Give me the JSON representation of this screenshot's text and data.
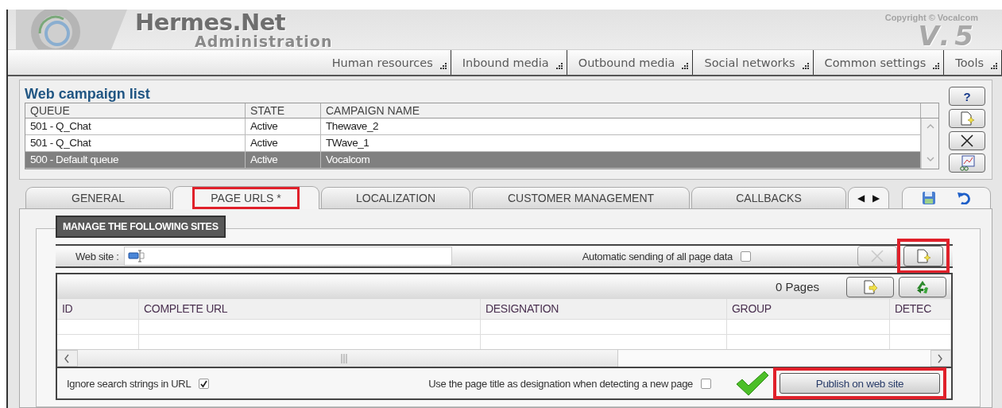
{
  "header": {
    "title": "Hermes.Net",
    "subtitle": "Administration",
    "copyright": "Copyright © Vocalcom",
    "version": "V.5"
  },
  "menu": [
    {
      "label": "Human resources"
    },
    {
      "label": "Inbound media"
    },
    {
      "label": "Outbound media"
    },
    {
      "label": "Social networks"
    },
    {
      "label": "Common settings"
    },
    {
      "label": "Tools"
    }
  ],
  "campaign_list": {
    "title": "Web campaign list",
    "columns": [
      "QUEUE",
      "STATE",
      "CAMPAIGN NAME"
    ],
    "rows": [
      {
        "cells": [
          "501 - Q_Chat",
          "Active",
          "Thewave_2"
        ],
        "selected": false
      },
      {
        "cells": [
          "501 - Q_Chat",
          "Active",
          "TWave_1"
        ],
        "selected": false
      },
      {
        "cells": [
          "500 - Default queue",
          "Active",
          "Vocalcom"
        ],
        "selected": true
      }
    ]
  },
  "side_buttons": [
    {
      "kind": "help",
      "label": "?"
    },
    {
      "kind": "new"
    },
    {
      "kind": "delete"
    },
    {
      "kind": "edit"
    }
  ],
  "tabs": [
    {
      "label": "GENERAL",
      "selected": false,
      "highlighted": false
    },
    {
      "label": "PAGE URLS *",
      "selected": true,
      "highlighted": true
    },
    {
      "label": "LOCALIZATION",
      "selected": false,
      "highlighted": false
    },
    {
      "label": "CUSTOMER MANAGEMENT",
      "selected": false,
      "highlighted": false
    },
    {
      "label": "CALLBACKS",
      "selected": false,
      "highlighted": false
    }
  ],
  "tab_nav": {
    "prev": "◀",
    "next": "▶"
  },
  "sites": {
    "group_title": "MANAGE THE FOLLOWING SITES",
    "web_site_label": "Web site :",
    "auto_send": {
      "label": "Automatic sending of all page data",
      "checked": false
    },
    "site_buttons": [
      {
        "kind": "delete",
        "disabled": true,
        "highlighted": false
      },
      {
        "kind": "add",
        "disabled": false,
        "highlighted": true
      }
    ],
    "page_count": "0 Pages",
    "grid_buttons": [
      {
        "kind": "export"
      },
      {
        "kind": "recycle"
      }
    ],
    "columns": [
      "ID",
      "COMPLETE URL",
      "DESIGNATION",
      "GROUP",
      "DETEC"
    ],
    "ignore_search": {
      "label": "Ignore search strings in URL",
      "checked": true
    },
    "use_title": {
      "label": "Use the page title as designation when detecting a new page",
      "checked": false
    },
    "publish": {
      "label": "Publish on web site",
      "highlighted": true
    }
  }
}
